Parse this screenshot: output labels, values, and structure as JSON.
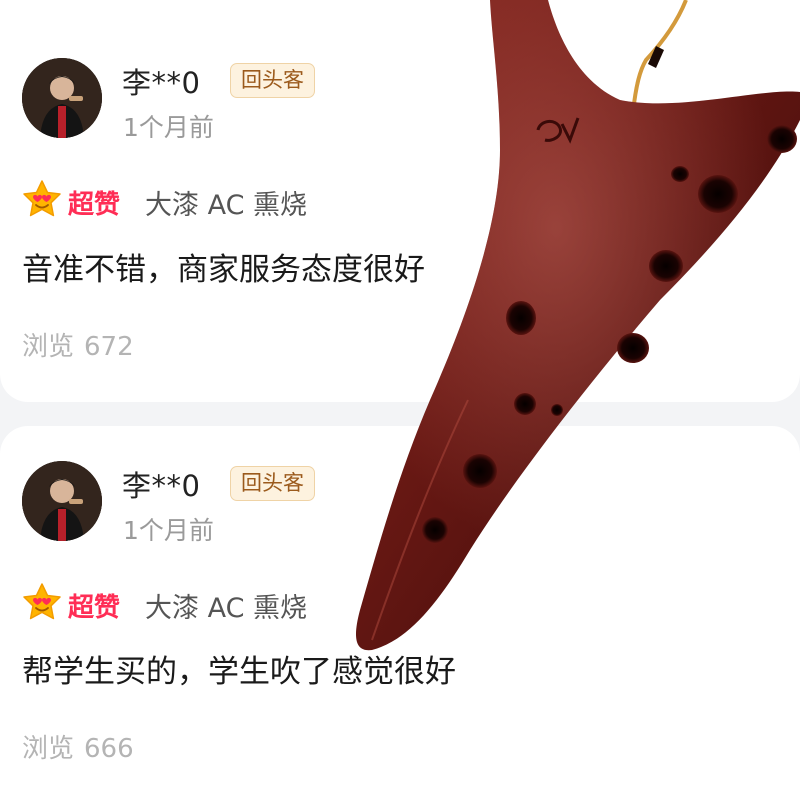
{
  "reviews": [
    {
      "username": "李**0",
      "badge": "回头客",
      "time": "1个月前",
      "rating_label": "超赞",
      "variant": "大漆 AC 熏烧",
      "text": "音准不错，商家服务态度很好",
      "views_label": "浏览",
      "views_count": "672"
    },
    {
      "username": "李**0",
      "badge": "回头客",
      "time": "1个月前",
      "rating_label": "超赞",
      "variant": "大漆 AC 熏烧",
      "text": "帮学生买的，学生吹了感觉很好",
      "views_label": "浏览",
      "views_count": "666"
    }
  ],
  "colors": {
    "rating_red": "#ff2d55",
    "badge_text": "#9b5a1c",
    "badge_bg": "#fdf2df",
    "ocarina": "#6e1a15"
  },
  "icons": {
    "star": "star-heart-eyes-icon",
    "avatar": "user-avatar-photo",
    "product": "ocarina-product-image"
  }
}
